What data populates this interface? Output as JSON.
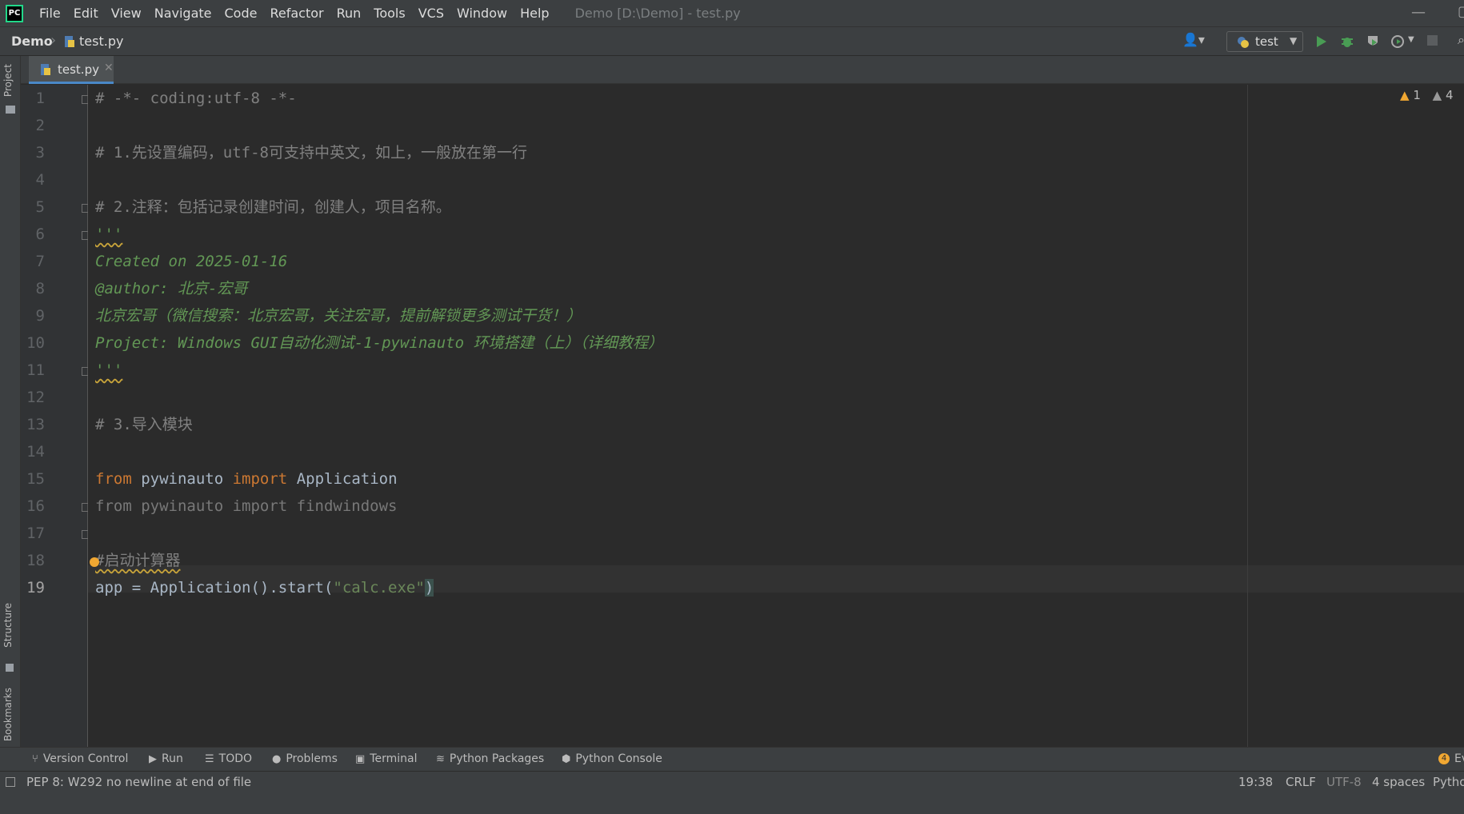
{
  "menu": {
    "items": [
      "File",
      "Edit",
      "View",
      "Navigate",
      "Code",
      "Refactor",
      "Run",
      "Tools",
      "VCS",
      "Window",
      "Help"
    ],
    "window_title": "Demo [D:\\Demo] - test.py"
  },
  "navbar": {
    "project": "Demo",
    "file": "test.py",
    "run_config": "test"
  },
  "left_strip": {
    "project": "Project",
    "structure": "Structure",
    "bookmarks": "Bookmarks"
  },
  "tabs": [
    {
      "label": "test.py",
      "active": true
    }
  ],
  "editor": {
    "current_line": 19,
    "warnings": "1",
    "warnings_2": "4",
    "line_numbers": [
      "1",
      "2",
      "3",
      "4",
      "5",
      "6",
      "7",
      "8",
      "9",
      "10",
      "11",
      "12",
      "13",
      "14",
      "15",
      "16",
      "17",
      "18",
      "19"
    ],
    "lines": {
      "l1": "# -*- coding:utf-8 -*-",
      "l3": "# 1.先设置编码，utf-8可支持中英文，如上，一般放在第一行",
      "l5": "# 2.注释：包括记录创建时间，创建人，项目名称。",
      "l6": "'''",
      "l7": "Created on 2025-01-16",
      "l8": "@author: 北京-宏哥",
      "l9": "北京宏哥（微信搜索：北京宏哥，关注宏哥，提前解锁更多测试干货！）",
      "l10": "Project: Windows GUI自动化测试-1-pywinauto 环境搭建（上）（详细教程）",
      "l11": "'''",
      "l13": "# 3.导入模块",
      "l15_kw1": "from",
      "l15_mid": " pywinauto ",
      "l15_kw2": "import",
      "l15_end": " Application",
      "l16": "from pywinauto import findwindows",
      "l18": "#启动计算器",
      "l19_a": "app = Application().start(",
      "l19_str": "\"calc.exe\"",
      "l19_b": ")"
    }
  },
  "tool_windows": [
    "Version Control",
    "Run",
    "TODO",
    "Problems",
    "Terminal",
    "Python Packages",
    "Python Console"
  ],
  "tool_windows_right": "Ev",
  "status": {
    "message": "PEP 8: W292 no newline at end of file",
    "position": "19:38",
    "line_sep": "CRLF",
    "encoding": "UTF-8",
    "indent": "4 spaces",
    "interpreter": "Pytho"
  },
  "colors": {
    "accent": "#4a88c7",
    "keyword": "#cc7832",
    "string": "#6a8759",
    "docstring": "#629755",
    "comment": "#808080"
  }
}
